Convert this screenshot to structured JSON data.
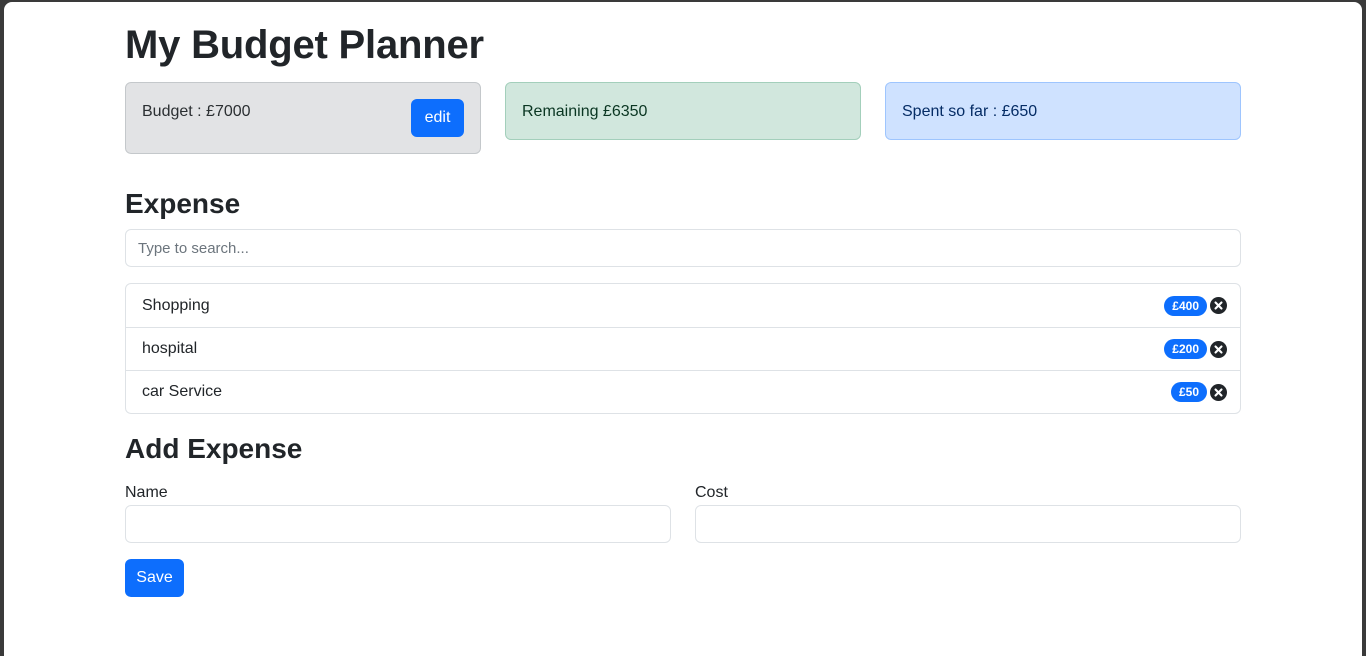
{
  "app": {
    "title": "My Budget Planner"
  },
  "summary": {
    "budget_text": "Budget : £7000",
    "edit_label": "edit",
    "remaining_text": "Remaining £6350",
    "spent_text": "Spent so far : £650"
  },
  "expense_section": {
    "heading": "Expense",
    "search_placeholder": "Type to search...",
    "items": [
      {
        "name": "Shopping",
        "cost": "£400",
        "delete_icon": "x-circle-icon"
      },
      {
        "name": "hospital",
        "cost": "£200",
        "delete_icon": "x-circle-icon"
      },
      {
        "name": "car Service",
        "cost": "£50",
        "delete_icon": "x-circle-icon"
      }
    ]
  },
  "add_expense": {
    "heading": "Add Expense",
    "name_label": "Name",
    "name_value": "",
    "cost_label": "Cost",
    "cost_value": "",
    "save_label": "Save"
  },
  "colors": {
    "primary": "#0d6efd",
    "secondary_bg": "#e2e3e5",
    "success_bg": "#d1e7dd",
    "primary_bg": "#cfe2ff"
  }
}
